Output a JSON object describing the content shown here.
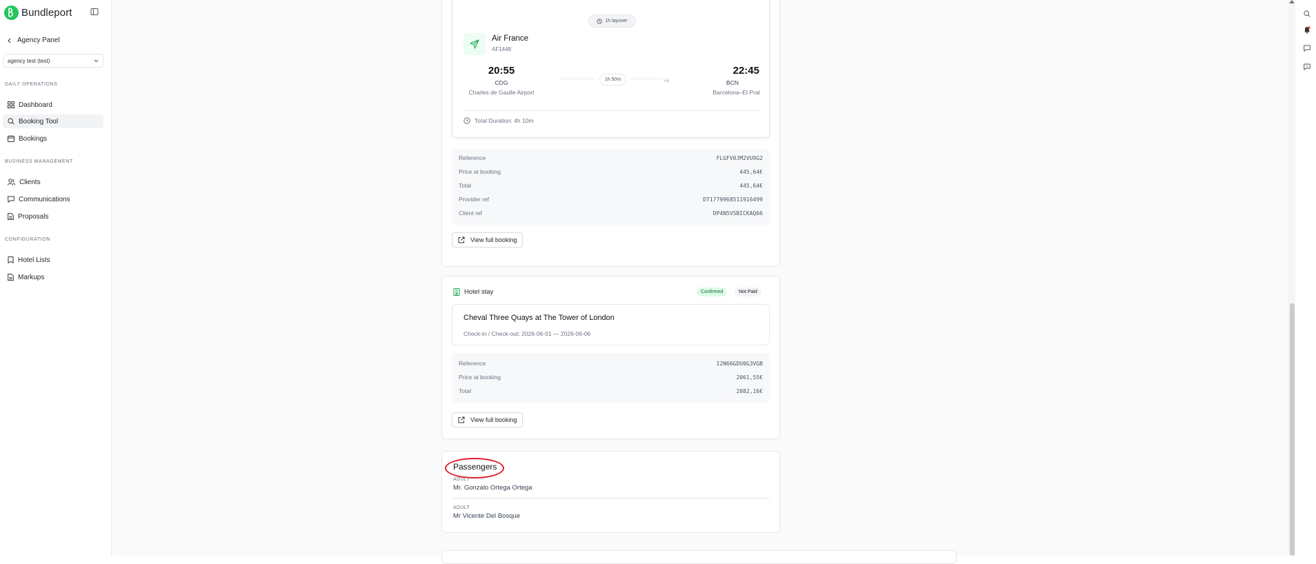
{
  "brand": {
    "name": "Bundleport",
    "accent": "#22c55e"
  },
  "sidebar": {
    "back_label": "Agency Panel",
    "agency_select_value": "agency test (test)",
    "sections": {
      "daily": "DAILY OPERATIONS",
      "business": "BUSINESS MANAGEMENT",
      "config": "CONFIGURATION"
    },
    "items": {
      "dashboard": "Dashboard",
      "booking_tool": "Booking Tool",
      "bookings": "Bookings",
      "clients": "Clients",
      "communications": "Communications",
      "proposals": "Proposals",
      "hotel_lists": "Hotel Lists",
      "markups": "Markups"
    }
  },
  "flight": {
    "layover": "1h layover",
    "airline": "Air France",
    "flight_no": "AF1448",
    "dep_time": "20:55",
    "dep_code": "CDG",
    "dep_airport": "Charles de Gaulle Airport",
    "duration": "1h 50m",
    "arr_time": "22:45",
    "arr_code": "BCN",
    "arr_airport": "Barcelona–El Prat",
    "total_duration": "Total Duration: 4h 10m",
    "details": {
      "reference_label": "Reference",
      "reference": "FLGFV0JM2VU9G2",
      "price_label": "Price at booking",
      "price": "445,64€",
      "total_label": "Total",
      "total": "445,64€",
      "provider_label": "Provider ref",
      "provider": "DT1779968511916499",
      "client_label": "Client ref",
      "client": "DP4N5VSBICKAQ66"
    },
    "view_button": "View full booking"
  },
  "hotel": {
    "section_title": "Hotel stay",
    "status_confirmed": "Confirmed",
    "status_paid": "Not Paid",
    "name": "Cheval Three Quays at The Tower of London",
    "dates": "Check-in / Check-out: 2026-06-01 — 2026-06-06",
    "details": {
      "reference_label": "Reference",
      "reference": "I2N66GDU0G3VGB",
      "price_label": "Price at booking",
      "price": "2061,55€",
      "total_label": "Total",
      "total": "2082,16€"
    },
    "view_button": "View full booking"
  },
  "passengers": {
    "title": "Passengers",
    "list": [
      {
        "type": "ADULT",
        "name": "Mr. Gonzalo Ortega Ortega"
      },
      {
        "type": "ADULT",
        "name": "Mr Vicente Del Bosque"
      }
    ]
  }
}
